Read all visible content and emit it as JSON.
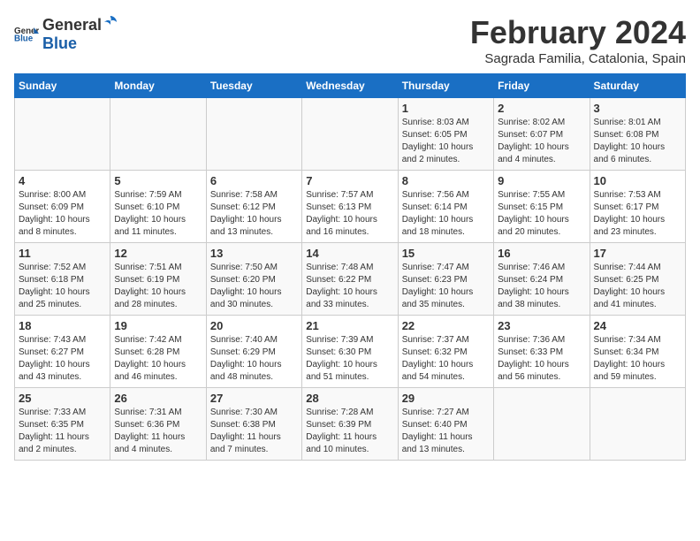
{
  "header": {
    "logo_general": "General",
    "logo_blue": "Blue",
    "title": "February 2024",
    "subtitle": "Sagrada Familia, Catalonia, Spain"
  },
  "weekdays": [
    "Sunday",
    "Monday",
    "Tuesday",
    "Wednesday",
    "Thursday",
    "Friday",
    "Saturday"
  ],
  "weeks": [
    [
      {
        "day": "",
        "info": ""
      },
      {
        "day": "",
        "info": ""
      },
      {
        "day": "",
        "info": ""
      },
      {
        "day": "",
        "info": ""
      },
      {
        "day": "1",
        "info": "Sunrise: 8:03 AM\nSunset: 6:05 PM\nDaylight: 10 hours\nand 2 minutes."
      },
      {
        "day": "2",
        "info": "Sunrise: 8:02 AM\nSunset: 6:07 PM\nDaylight: 10 hours\nand 4 minutes."
      },
      {
        "day": "3",
        "info": "Sunrise: 8:01 AM\nSunset: 6:08 PM\nDaylight: 10 hours\nand 6 minutes."
      }
    ],
    [
      {
        "day": "4",
        "info": "Sunrise: 8:00 AM\nSunset: 6:09 PM\nDaylight: 10 hours\nand 8 minutes."
      },
      {
        "day": "5",
        "info": "Sunrise: 7:59 AM\nSunset: 6:10 PM\nDaylight: 10 hours\nand 11 minutes."
      },
      {
        "day": "6",
        "info": "Sunrise: 7:58 AM\nSunset: 6:12 PM\nDaylight: 10 hours\nand 13 minutes."
      },
      {
        "day": "7",
        "info": "Sunrise: 7:57 AM\nSunset: 6:13 PM\nDaylight: 10 hours\nand 16 minutes."
      },
      {
        "day": "8",
        "info": "Sunrise: 7:56 AM\nSunset: 6:14 PM\nDaylight: 10 hours\nand 18 minutes."
      },
      {
        "day": "9",
        "info": "Sunrise: 7:55 AM\nSunset: 6:15 PM\nDaylight: 10 hours\nand 20 minutes."
      },
      {
        "day": "10",
        "info": "Sunrise: 7:53 AM\nSunset: 6:17 PM\nDaylight: 10 hours\nand 23 minutes."
      }
    ],
    [
      {
        "day": "11",
        "info": "Sunrise: 7:52 AM\nSunset: 6:18 PM\nDaylight: 10 hours\nand 25 minutes."
      },
      {
        "day": "12",
        "info": "Sunrise: 7:51 AM\nSunset: 6:19 PM\nDaylight: 10 hours\nand 28 minutes."
      },
      {
        "day": "13",
        "info": "Sunrise: 7:50 AM\nSunset: 6:20 PM\nDaylight: 10 hours\nand 30 minutes."
      },
      {
        "day": "14",
        "info": "Sunrise: 7:48 AM\nSunset: 6:22 PM\nDaylight: 10 hours\nand 33 minutes."
      },
      {
        "day": "15",
        "info": "Sunrise: 7:47 AM\nSunset: 6:23 PM\nDaylight: 10 hours\nand 35 minutes."
      },
      {
        "day": "16",
        "info": "Sunrise: 7:46 AM\nSunset: 6:24 PM\nDaylight: 10 hours\nand 38 minutes."
      },
      {
        "day": "17",
        "info": "Sunrise: 7:44 AM\nSunset: 6:25 PM\nDaylight: 10 hours\nand 41 minutes."
      }
    ],
    [
      {
        "day": "18",
        "info": "Sunrise: 7:43 AM\nSunset: 6:27 PM\nDaylight: 10 hours\nand 43 minutes."
      },
      {
        "day": "19",
        "info": "Sunrise: 7:42 AM\nSunset: 6:28 PM\nDaylight: 10 hours\nand 46 minutes."
      },
      {
        "day": "20",
        "info": "Sunrise: 7:40 AM\nSunset: 6:29 PM\nDaylight: 10 hours\nand 48 minutes."
      },
      {
        "day": "21",
        "info": "Sunrise: 7:39 AM\nSunset: 6:30 PM\nDaylight: 10 hours\nand 51 minutes."
      },
      {
        "day": "22",
        "info": "Sunrise: 7:37 AM\nSunset: 6:32 PM\nDaylight: 10 hours\nand 54 minutes."
      },
      {
        "day": "23",
        "info": "Sunrise: 7:36 AM\nSunset: 6:33 PM\nDaylight: 10 hours\nand 56 minutes."
      },
      {
        "day": "24",
        "info": "Sunrise: 7:34 AM\nSunset: 6:34 PM\nDaylight: 10 hours\nand 59 minutes."
      }
    ],
    [
      {
        "day": "25",
        "info": "Sunrise: 7:33 AM\nSunset: 6:35 PM\nDaylight: 11 hours\nand 2 minutes."
      },
      {
        "day": "26",
        "info": "Sunrise: 7:31 AM\nSunset: 6:36 PM\nDaylight: 11 hours\nand 4 minutes."
      },
      {
        "day": "27",
        "info": "Sunrise: 7:30 AM\nSunset: 6:38 PM\nDaylight: 11 hours\nand 7 minutes."
      },
      {
        "day": "28",
        "info": "Sunrise: 7:28 AM\nSunset: 6:39 PM\nDaylight: 11 hours\nand 10 minutes."
      },
      {
        "day": "29",
        "info": "Sunrise: 7:27 AM\nSunset: 6:40 PM\nDaylight: 11 hours\nand 13 minutes."
      },
      {
        "day": "",
        "info": ""
      },
      {
        "day": "",
        "info": ""
      }
    ]
  ]
}
